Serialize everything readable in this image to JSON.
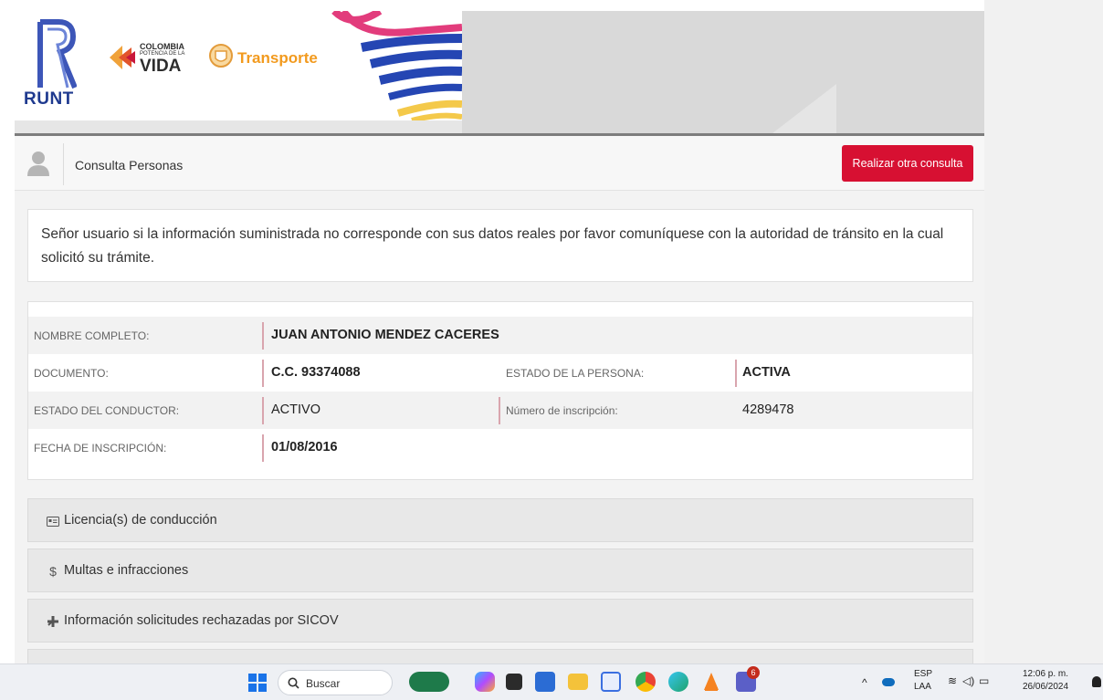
{
  "header": {
    "runt_label": "RUNT",
    "colombia_line1": "COLOMBIA",
    "colombia_line2": "POTENCIA DE LA",
    "colombia_line3": "VIDA",
    "ministry_label": "Transporte"
  },
  "consulta": {
    "title": "Consulta Personas",
    "button_label": "Realizar otra consulta"
  },
  "notice": "Señor usuario si la información suministrada no corresponde con sus datos reales por favor comuníquese con la autoridad de tránsito en la cual solicitó su trámite.",
  "person": {
    "nombre_label": "NOMBRE COMPLETO:",
    "nombre_value": "JUAN ANTONIO MENDEZ CACERES",
    "documento_label": "DOCUMENTO:",
    "documento_value": "C.C. 93374088",
    "estado_persona_label": "ESTADO DE LA PERSONA:",
    "estado_persona_value": "ACTIVA",
    "estado_conductor_label": "ESTADO DEL CONDUCTOR:",
    "estado_conductor_value": "ACTIVO",
    "inscripcion_num_label": "Número de inscripción:",
    "inscripcion_num_value": "4289478",
    "fecha_label": "FECHA DE INSCRIPCIÓN:",
    "fecha_value": "01/08/2016"
  },
  "sections": [
    {
      "label": "Licencia(s) de conducción",
      "icon": "license-card-icon"
    },
    {
      "label": "Multas e infracciones",
      "icon": "dollar-icon"
    },
    {
      "label": "Información solicitudes rechazadas por SICOV",
      "icon": "plus-icon"
    }
  ],
  "taskbar": {
    "search_label": "Buscar",
    "lang_top": "ESP",
    "lang_bottom": "LAA",
    "time": "12:06 p. m.",
    "date": "26/06/2024",
    "teams_badge": "6"
  },
  "colors": {
    "accent_red": "#d71032",
    "runt_blue": "#1f3a8f",
    "transporte_orange": "#f29a1e"
  }
}
